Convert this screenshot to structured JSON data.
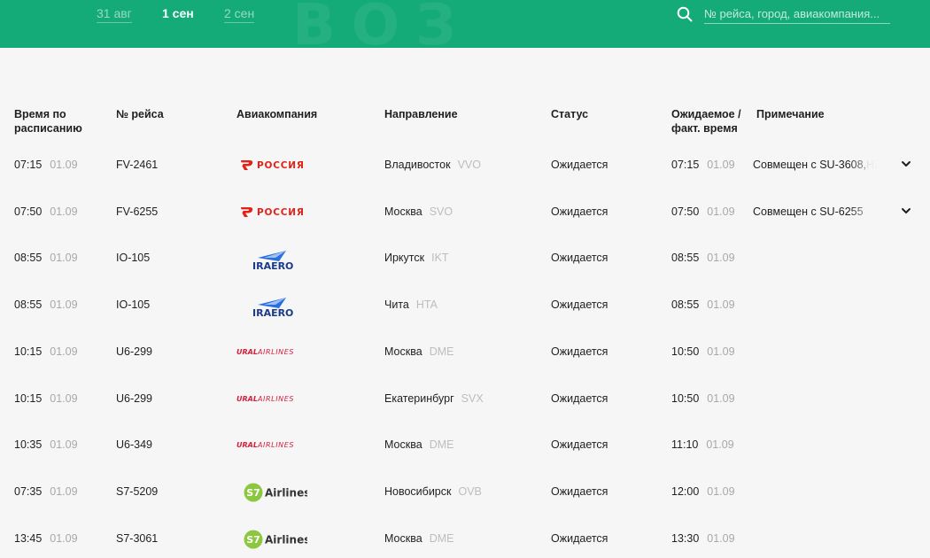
{
  "header": {
    "dates": [
      {
        "label": "31 авг",
        "active": false
      },
      {
        "label": "1 сен",
        "active": true
      },
      {
        "label": "2 сен",
        "active": false
      }
    ],
    "search": {
      "placeholder": "№ рейса, город, авиакомпания..."
    },
    "colors": {
      "brand": "#14ab78"
    }
  },
  "table": {
    "headers": {
      "time": "Время по расписанию",
      "flight": "№ рейса",
      "airline": "Авиакомпания",
      "direction": "Направление",
      "status": "Статус",
      "actual": "Ожидаемое / факт. время",
      "note": "Примечание"
    },
    "rows": [
      {
        "time": "07:15",
        "date": "01.09",
        "flight": "FV-2461",
        "airline": "rossiya",
        "city": "Владивосток",
        "iata": "VVO",
        "status": "Ожидается",
        "exp_time": "07:15",
        "exp_date": "01.09",
        "note": "Совмещен с SU-3608, ",
        "note_more": "HZ"
      },
      {
        "time": "07:50",
        "date": "01.09",
        "flight": "FV-6255",
        "airline": "rossiya",
        "city": "Москва",
        "iata": "SVO",
        "status": "Ожидается",
        "exp_time": "07:50",
        "exp_date": "01.09",
        "note": "Совмещен с SU-6255",
        "note_more": ""
      },
      {
        "time": "08:55",
        "date": "01.09",
        "flight": "IO-105",
        "airline": "iraero",
        "city": "Иркутск",
        "iata": "IKT",
        "status": "Ожидается",
        "exp_time": "08:55",
        "exp_date": "01.09",
        "note": "",
        "note_more": ""
      },
      {
        "time": "08:55",
        "date": "01.09",
        "flight": "IO-105",
        "airline": "iraero",
        "city": "Чита",
        "iata": "HTA",
        "status": "Ожидается",
        "exp_time": "08:55",
        "exp_date": "01.09",
        "note": "",
        "note_more": ""
      },
      {
        "time": "10:15",
        "date": "01.09",
        "flight": "U6-299",
        "airline": "ural",
        "city": "Москва",
        "iata": "DME",
        "status": "Ожидается",
        "exp_time": "10:50",
        "exp_date": "01.09",
        "note": "",
        "note_more": ""
      },
      {
        "time": "10:15",
        "date": "01.09",
        "flight": "U6-299",
        "airline": "ural",
        "city": "Екатеринбург",
        "iata": "SVX",
        "status": "Ожидается",
        "exp_time": "10:50",
        "exp_date": "01.09",
        "note": "",
        "note_more": ""
      },
      {
        "time": "10:35",
        "date": "01.09",
        "flight": "U6-349",
        "airline": "ural",
        "city": "Москва",
        "iata": "DME",
        "status": "Ожидается",
        "exp_time": "11:10",
        "exp_date": "01.09",
        "note": "",
        "note_more": ""
      },
      {
        "time": "07:35",
        "date": "01.09",
        "flight": "S7-5209",
        "airline": "s7",
        "city": "Новосибирск",
        "iata": "OVB",
        "status": "Ожидается",
        "exp_time": "12:00",
        "exp_date": "01.09",
        "note": "",
        "note_more": ""
      },
      {
        "time": "13:45",
        "date": "01.09",
        "flight": "S7-3061",
        "airline": "s7",
        "city": "Москва",
        "iata": "DME",
        "status": "Ожидается",
        "exp_time": "13:30",
        "exp_date": "01.09",
        "note": "",
        "note_more": ""
      }
    ]
  },
  "logos": {
    "rossiya": {
      "text": "РОССИЯ",
      "color": "#e2231a"
    },
    "iraero": {
      "text": "IRAERO",
      "color": "#1a3a8a",
      "accent": "#2a6fe0"
    },
    "ural": {
      "text_bold": "URAL",
      "text_light": "AIRLINES",
      "color": "#d71e3c"
    },
    "s7": {
      "badge": "S7",
      "text": "Airlines",
      "color": "#8dc63f",
      "text_color": "#333333"
    }
  }
}
